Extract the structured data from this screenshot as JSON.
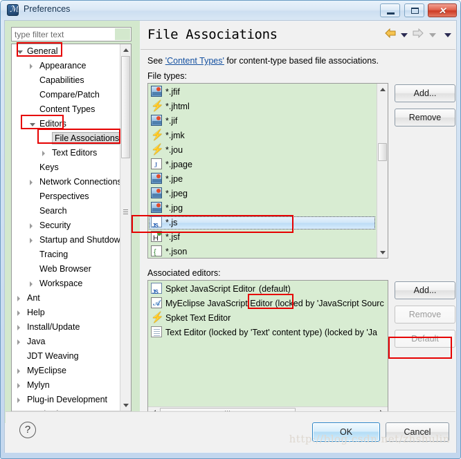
{
  "window": {
    "title": "Preferences",
    "icon": "preferences-icon",
    "minimize_label": "Minimize",
    "maximize_label": "Maximize",
    "close_label": "✕"
  },
  "sidebar": {
    "filter": {
      "placeholder": "type filter text",
      "value": ""
    },
    "items": [
      {
        "label": "General",
        "indent": 0,
        "twisty": "open",
        "selected": false
      },
      {
        "label": "Appearance",
        "indent": 1,
        "twisty": "closed",
        "selected": false
      },
      {
        "label": "Capabilities",
        "indent": 1,
        "twisty": "none",
        "selected": false
      },
      {
        "label": "Compare/Patch",
        "indent": 1,
        "twisty": "none",
        "selected": false
      },
      {
        "label": "Content Types",
        "indent": 1,
        "twisty": "none",
        "selected": false
      },
      {
        "label": "Editors",
        "indent": 1,
        "twisty": "open",
        "selected": false
      },
      {
        "label": "File Associations",
        "indent": 2,
        "twisty": "none",
        "selected": true
      },
      {
        "label": "Text Editors",
        "indent": 2,
        "twisty": "closed",
        "selected": false
      },
      {
        "label": "Keys",
        "indent": 1,
        "twisty": "none",
        "selected": false
      },
      {
        "label": "Network Connections",
        "indent": 1,
        "twisty": "closed",
        "selected": false
      },
      {
        "label": "Perspectives",
        "indent": 1,
        "twisty": "none",
        "selected": false
      },
      {
        "label": "Search",
        "indent": 1,
        "twisty": "none",
        "selected": false
      },
      {
        "label": "Security",
        "indent": 1,
        "twisty": "closed",
        "selected": false
      },
      {
        "label": "Startup and Shutdown",
        "indent": 1,
        "twisty": "closed",
        "selected": false
      },
      {
        "label": "Tracing",
        "indent": 1,
        "twisty": "none",
        "selected": false
      },
      {
        "label": "Web Browser",
        "indent": 1,
        "twisty": "none",
        "selected": false
      },
      {
        "label": "Workspace",
        "indent": 1,
        "twisty": "closed",
        "selected": false
      },
      {
        "label": "Ant",
        "indent": 0,
        "twisty": "closed",
        "selected": false
      },
      {
        "label": "Help",
        "indent": 0,
        "twisty": "closed",
        "selected": false
      },
      {
        "label": "Install/Update",
        "indent": 0,
        "twisty": "closed",
        "selected": false
      },
      {
        "label": "Java",
        "indent": 0,
        "twisty": "closed",
        "selected": false
      },
      {
        "label": "JDT Weaving",
        "indent": 0,
        "twisty": "none",
        "selected": false
      },
      {
        "label": "MyEclipse",
        "indent": 0,
        "twisty": "closed",
        "selected": false
      },
      {
        "label": "Mylyn",
        "indent": 0,
        "twisty": "closed",
        "selected": false
      },
      {
        "label": "Plug-in Development",
        "indent": 0,
        "twisty": "closed",
        "selected": false
      },
      {
        "label": "Run/Debug",
        "indent": 0,
        "twisty": "closed",
        "selected": false
      }
    ]
  },
  "page": {
    "title": "File Associations",
    "nav": {
      "back_icon": "back-arrow-icon",
      "back_menu_icon": "chevron-down-icon",
      "forward_icon": "forward-arrow-icon",
      "forward_menu_icon": "chevron-down-icon",
      "view_menu_icon": "chevron-down-icon"
    },
    "description_prefix": "See ",
    "description_link": "'Content Types'",
    "description_suffix": " for content-type based file associations.",
    "file_types_label": "File types:",
    "associated_editors_label": "Associated editors:"
  },
  "file_types": {
    "buttons": {
      "add": "Add...",
      "remove": "Remove"
    },
    "add_enabled": true,
    "remove_enabled": true,
    "items": [
      {
        "label": "*.jfif",
        "icon": "image-file-icon",
        "selected": false
      },
      {
        "label": "*.jhtml",
        "icon": "bolt-file-icon",
        "selected": false
      },
      {
        "label": "*.jif",
        "icon": "image-file-icon",
        "selected": false
      },
      {
        "label": "*.jmk",
        "icon": "bolt-file-icon",
        "selected": false
      },
      {
        "label": "*.jou",
        "icon": "bolt-file-icon",
        "selected": false
      },
      {
        "label": "*.jpage",
        "icon": "java-page-icon",
        "selected": false
      },
      {
        "label": "*.jpe",
        "icon": "image-file-icon",
        "selected": false
      },
      {
        "label": "*.jpeg",
        "icon": "image-file-icon",
        "selected": false
      },
      {
        "label": "*.jpg",
        "icon": "image-file-icon",
        "selected": false
      },
      {
        "label": "*.js",
        "icon": "javascript-file-icon",
        "selected": true
      },
      {
        "label": "*.jsf",
        "icon": "jsf-file-icon",
        "selected": false
      },
      {
        "label": "*.json",
        "icon": "json-file-icon",
        "selected": false
      }
    ]
  },
  "associated_editors": {
    "buttons": {
      "add": "Add...",
      "remove": "Remove",
      "default": "Default"
    },
    "add_enabled": true,
    "remove_enabled": false,
    "default_enabled": false,
    "items": [
      {
        "label": "Spket JavaScript Editor",
        "suffix": "(default)",
        "icon": "javascript-editor-icon"
      },
      {
        "label": "MyEclipse JavaScript Editor (locked by 'JavaScript Sourc",
        "suffix": "",
        "icon": "myeclipse-editor-icon"
      },
      {
        "label": "Spket Text Editor",
        "suffix": "",
        "icon": "bolt-file-icon"
      },
      {
        "label": "Text Editor (locked by 'Text' content type) (locked by 'Ja",
        "suffix": "",
        "icon": "text-editor-icon"
      }
    ]
  },
  "footer": {
    "help_label": "?",
    "ok_label": "OK",
    "cancel_label": "Cancel",
    "watermark": "http://blog.csdn.net/zhshulin"
  },
  "colors": {
    "list_background": "#d8ecd2",
    "selection": "#bcdcf5",
    "annotation": "#e60000",
    "link": "#1450a0"
  }
}
